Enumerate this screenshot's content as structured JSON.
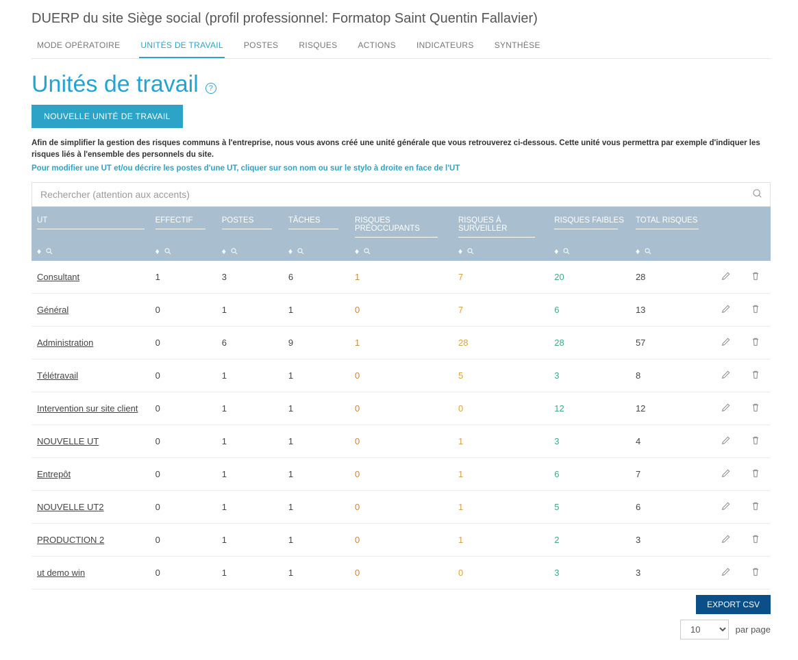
{
  "pageTitle": "DUERP du site Siège social (profil professionnel: Formatop Saint Quentin Fallavier)",
  "tabs": [
    "MODE OPÉRATOIRE",
    "UNITÉS DE TRAVAIL",
    "POSTES",
    "RISQUES",
    "ACTIONS",
    "INDICATEURS",
    "SYNTHÈSE"
  ],
  "activeTab": 1,
  "heading": "Unités de travail",
  "newButton": "NOUVELLE UNITÉ DE TRAVAIL",
  "note": "Afin de simplifier la gestion des risques communs à l'entreprise, nous vous avons créé une unité générale que vous retrouverez ci-dessous. Cette unité vous permettra par exemple d'indiquer les risques liés à l'ensemble des personnels du site.",
  "hint": "Pour modifier une UT et/ou décrire les postes d'une UT, cliquer sur son nom ou sur le stylo à droite en face de l'UT",
  "searchPlaceholder": "Rechercher (attention aux accents)",
  "columns": [
    "UT",
    "EFFECTIF",
    "POSTES",
    "TÂCHES",
    "RISQUES PRÉOCCUPANTS",
    "RISQUES À SURVEILLER",
    "RISQUES FAIBLES",
    "TOTAL RISQUES"
  ],
  "rows": [
    {
      "ut": "Consultant",
      "effectif": "1",
      "postes": "3",
      "taches": "6",
      "preocc": "1",
      "surv": "7",
      "faible": "20",
      "total": "28"
    },
    {
      "ut": "Général",
      "effectif": "0",
      "postes": "1",
      "taches": "1",
      "preocc": "0",
      "surv": "7",
      "faible": "6",
      "total": "13"
    },
    {
      "ut": "Administration",
      "effectif": "0",
      "postes": "6",
      "taches": "9",
      "preocc": "1",
      "surv": "28",
      "faible": "28",
      "total": "57"
    },
    {
      "ut": "Télétravail",
      "effectif": "0",
      "postes": "1",
      "taches": "1",
      "preocc": "0",
      "surv": "5",
      "faible": "3",
      "total": "8"
    },
    {
      "ut": "Intervention sur site client",
      "effectif": "0",
      "postes": "1",
      "taches": "1",
      "preocc": "0",
      "surv": "0",
      "faible": "12",
      "total": "12"
    },
    {
      "ut": "NOUVELLE UT",
      "effectif": "0",
      "postes": "1",
      "taches": "1",
      "preocc": "0",
      "surv": "1",
      "faible": "3",
      "total": "4"
    },
    {
      "ut": "Entrepôt",
      "effectif": "0",
      "postes": "1",
      "taches": "1",
      "preocc": "0",
      "surv": "1",
      "faible": "6",
      "total": "7"
    },
    {
      "ut": "NOUVELLE UT2",
      "effectif": "0",
      "postes": "1",
      "taches": "1",
      "preocc": "0",
      "surv": "1",
      "faible": "5",
      "total": "6"
    },
    {
      "ut": "PRODUCTION 2",
      "effectif": "0",
      "postes": "1",
      "taches": "1",
      "preocc": "0",
      "surv": "1",
      "faible": "2",
      "total": "3"
    },
    {
      "ut": "ut demo win",
      "effectif": "0",
      "postes": "1",
      "taches": "1",
      "preocc": "0",
      "surv": "0",
      "faible": "3",
      "total": "3"
    }
  ],
  "export": "EXPORT CSV",
  "perPage": "10",
  "perPageLabel": "par page"
}
